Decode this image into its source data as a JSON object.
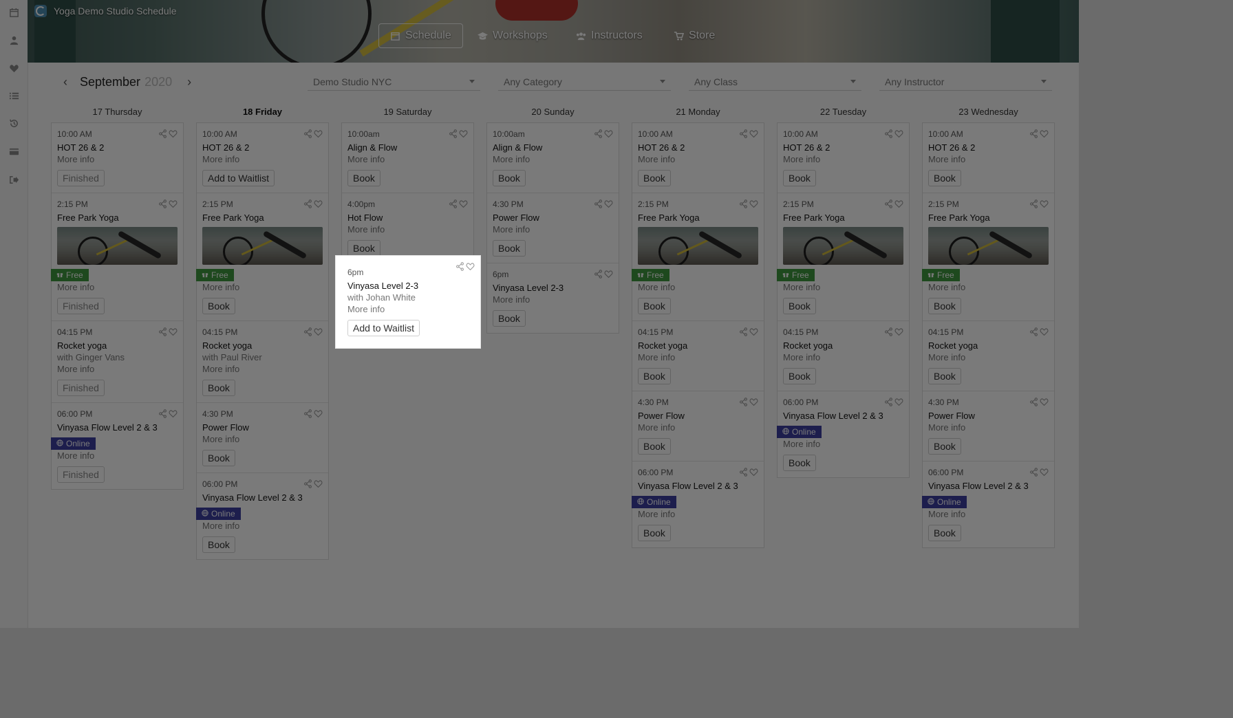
{
  "app": {
    "title": "Yoga Demo Studio Schedule"
  },
  "nav": [
    {
      "label": "Schedule",
      "icon": "calendar-icon"
    },
    {
      "label": "Workshops",
      "icon": "graduation-cap-icon"
    },
    {
      "label": "Instructors",
      "icon": "users-icon"
    },
    {
      "label": "Store",
      "icon": "cart-icon"
    }
  ],
  "sidebar": [
    "calendar-icon",
    "user-icon",
    "heart-icon",
    "list-icon",
    "history-icon",
    "credit-card-icon",
    "sign-out-icon"
  ],
  "filters": {
    "month": "September",
    "year": "2020",
    "studio": "Demo Studio NYC",
    "category": "Any Category",
    "class": "Any Class",
    "instructor": "Any Instructor"
  },
  "days": [
    {
      "label": "17 Thursday",
      "classes": [
        {
          "time": "10:00 AM",
          "name": "HOT 26 & 2",
          "more": "More info",
          "action": "Finished"
        },
        {
          "time": "2:15 PM",
          "name": "Free Park Yoga",
          "image": true,
          "badge": "Free",
          "more": "More info",
          "action": "Finished"
        },
        {
          "time": "04:15 PM",
          "name": "Rocket yoga",
          "instructor": "with Ginger Vans",
          "more": "More info",
          "action": "Finished"
        },
        {
          "time": "06:00 PM",
          "name": "Vinyasa Flow Level 2 & 3",
          "badge": "Online",
          "more": "More info",
          "action": "Finished"
        }
      ]
    },
    {
      "label": "18 Friday",
      "bold": true,
      "classes": [
        {
          "time": "10:00 AM",
          "name": "HOT 26 & 2",
          "more": "More info",
          "action": "Add to Waitlist"
        },
        {
          "time": "2:15 PM",
          "name": "Free Park Yoga",
          "image": true,
          "badge": "Free",
          "more": "More info",
          "action": "Book"
        },
        {
          "time": "04:15 PM",
          "name": "Rocket yoga",
          "instructor": "with Paul River",
          "more": "More info",
          "action": "Book"
        },
        {
          "time": "4:30 PM",
          "name": "Power Flow",
          "more": "More info",
          "action": "Book"
        },
        {
          "time": "06:00 PM",
          "name": "Vinyasa Flow Level 2 & 3",
          "badge": "Online",
          "more": "More info",
          "action": "Book"
        }
      ]
    },
    {
      "label": "19 Saturday",
      "classes": [
        {
          "time": "10:00am",
          "name": "Align & Flow",
          "more": "More info",
          "action": "Book"
        },
        {
          "time": "4:00pm",
          "name": "Hot Flow",
          "more": "More info",
          "action": "Book"
        },
        {
          "time": "6pm",
          "name": "Vinyasa Level 2-3",
          "instructor": "with Johan White",
          "more": "More info",
          "action": "Add to Waitlist",
          "highlight": true
        }
      ]
    },
    {
      "label": "20 Sunday",
      "classes": [
        {
          "time": "10:00am",
          "name": "Align & Flow",
          "more": "More info",
          "action": "Book"
        },
        {
          "time": "4:30 PM",
          "name": "Power Flow",
          "more": "More info",
          "action": "Book"
        },
        {
          "time": "6pm",
          "name": "Vinyasa Level 2-3",
          "more": "More info",
          "action": "Book"
        }
      ]
    },
    {
      "label": "21 Monday",
      "classes": [
        {
          "time": "10:00 AM",
          "name": "HOT 26 & 2",
          "more": "More info",
          "action": "Book"
        },
        {
          "time": "2:15 PM",
          "name": "Free Park Yoga",
          "image": true,
          "badge": "Free",
          "more": "More info",
          "action": "Book"
        },
        {
          "time": "04:15 PM",
          "name": "Rocket yoga",
          "more": "More info",
          "action": "Book"
        },
        {
          "time": "4:30 PM",
          "name": "Power Flow",
          "more": "More info",
          "action": "Book"
        },
        {
          "time": "06:00 PM",
          "name": "Vinyasa Flow Level 2 & 3",
          "badge": "Online",
          "more": "More info",
          "action": "Book"
        }
      ]
    },
    {
      "label": "22 Tuesday",
      "classes": [
        {
          "time": "10:00 AM",
          "name": "HOT 26 & 2",
          "more": "More info",
          "action": "Book"
        },
        {
          "time": "2:15 PM",
          "name": "Free Park Yoga",
          "image": true,
          "badge": "Free",
          "more": "More info",
          "action": "Book"
        },
        {
          "time": "04:15 PM",
          "name": "Rocket yoga",
          "more": "More info",
          "action": "Book"
        },
        {
          "time": "06:00 PM",
          "name": "Vinyasa Flow Level 2 & 3",
          "badge": "Online",
          "more": "More info",
          "action": "Book"
        }
      ]
    },
    {
      "label": "23 Wednesday",
      "classes": [
        {
          "time": "10:00 AM",
          "name": "HOT 26 & 2",
          "more": "More info",
          "action": "Book"
        },
        {
          "time": "2:15 PM",
          "name": "Free Park Yoga",
          "image": true,
          "badge": "Free",
          "more": "More info",
          "action": "Book"
        },
        {
          "time": "04:15 PM",
          "name": "Rocket yoga",
          "more": "More info",
          "action": "Book"
        },
        {
          "time": "4:30 PM",
          "name": "Power Flow",
          "more": "More info",
          "action": "Book"
        },
        {
          "time": "06:00 PM",
          "name": "Vinyasa Flow Level 2 & 3",
          "badge": "Online",
          "more": "More info",
          "action": "Book"
        }
      ]
    }
  ],
  "colors": {
    "free": "#3f9a3f",
    "online": "#3d3fa1",
    "logo": "#4d8fb3"
  }
}
